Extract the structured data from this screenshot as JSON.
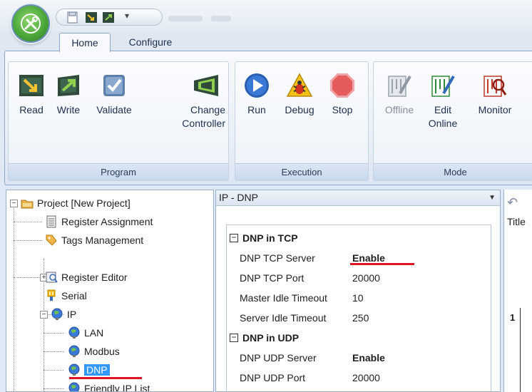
{
  "ribbon": {
    "tabs": [
      {
        "label": "Home"
      },
      {
        "label": "Configure"
      }
    ],
    "groups": {
      "program": {
        "label": "Program",
        "buttons": [
          {
            "label": "Read",
            "icon": "read-icon"
          },
          {
            "label": "Write",
            "icon": "write-icon"
          },
          {
            "label": "Validate",
            "icon": "validate-icon"
          },
          {
            "label": "Change\nController",
            "icon": "change-controller-icon"
          }
        ]
      },
      "execution": {
        "label": "Execution",
        "buttons": [
          {
            "label": "Run",
            "icon": "run-icon"
          },
          {
            "label": "Debug",
            "icon": "debug-icon"
          },
          {
            "label": "Stop",
            "icon": "stop-icon"
          }
        ]
      },
      "mode": {
        "label": "Mode",
        "buttons": [
          {
            "label": "Offline",
            "icon": "offline-icon",
            "disabled": true
          },
          {
            "label": "Edit\nOnline",
            "icon": "edit-online-icon"
          },
          {
            "label": "Monitor",
            "icon": "monitor-icon"
          }
        ]
      }
    }
  },
  "tree": {
    "items": [
      {
        "label": "Project [New Project]",
        "icon": "project-folder-icon"
      },
      {
        "label": "Register Assignment",
        "icon": "register-assignment-icon"
      },
      {
        "label": "Tags Management",
        "icon": "tag-icon"
      },
      {
        "label": "Register Editor",
        "icon": "register-editor-icon"
      },
      {
        "label": "Serial",
        "icon": "serial-icon"
      },
      {
        "label": "IP",
        "icon": "ip-globe-icon"
      },
      {
        "label": "LAN",
        "icon": "globe-icon"
      },
      {
        "label": "Modbus",
        "icon": "globe-icon"
      },
      {
        "label": "DNP",
        "icon": "globe-icon",
        "selected": true
      },
      {
        "label": "Friendly IP List",
        "icon": "globe-icon"
      }
    ]
  },
  "properties": {
    "header": "IP - DNP",
    "rows": [
      {
        "type": "category",
        "name": "DNP in TCP"
      },
      {
        "type": "prop",
        "name": "DNP TCP Server",
        "value": "Enable",
        "bold": true
      },
      {
        "type": "prop",
        "name": "DNP TCP Port",
        "value": "20000"
      },
      {
        "type": "prop",
        "name": "Master Idle Timeout",
        "value": "10"
      },
      {
        "type": "prop",
        "name": "Server Idle Timeout",
        "value": "250"
      },
      {
        "type": "category",
        "name": "DNP in UDP"
      },
      {
        "type": "prop",
        "name": "DNP UDP Server",
        "value": "Enable",
        "bold": true
      },
      {
        "type": "prop",
        "name": "DNP UDP Port",
        "value": "20000"
      }
    ]
  },
  "right_pane": {
    "title": "Title",
    "row_number": "1"
  },
  "colors": {
    "annotation_red": "#e0141e",
    "selection_blue": "#3399ff"
  }
}
